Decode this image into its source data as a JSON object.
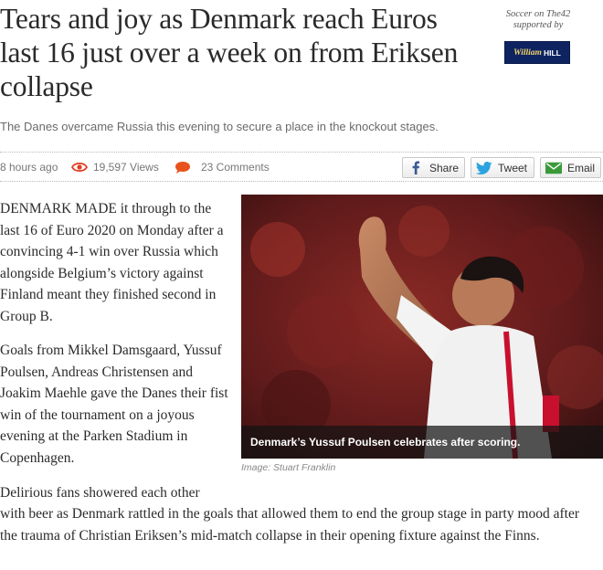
{
  "article": {
    "headline": "Tears and joy as Denmark reach Euros last 16 just over a week on from Eriksen collapse",
    "standfirst": "The Danes overcame Russia this evening to secure a place in the knockout stages.",
    "sponsor_line1": "Soccer on The42",
    "sponsor_line2": "supported by",
    "sponsor_logo": "William Hill",
    "sponsor_logo_script": "William",
    "sponsor_logo_bold": "HILL"
  },
  "meta": {
    "time": "8 hours ago",
    "views": "19,597 Views",
    "comments": "23 Comments",
    "views_icon": "eye-icon",
    "comments_icon": "speech-bubble-icon"
  },
  "share": {
    "facebook": "Share",
    "twitter": "Tweet",
    "email": "Email"
  },
  "body": {
    "p1": "DENMARK MADE it through to the last 16 of Euro 2020 on Monday after a convincing 4-1 win over Russia which alongside Belgium’s victory against Finland meant they finished second in Group B.",
    "p2": "Goals from Mikkel Damsgaard, Yussuf Poulsen, Andreas Christensen and Joakim Maehle gave the Danes their fist win of the tournament on a joyous evening at the Parken Stadium in Copenhagen.",
    "p3_a": "Delirious fans showered each other",
    "p3_b": "with beer as Denmark rattled in the goals that allowed them to end the group stage in party mood after the trauma of Christian Eriksen’s mid-match collapse in their opening fixture against the Finns."
  },
  "photo": {
    "caption": "Denmark’s Yussuf Poulsen celebrates after scoring.",
    "credit": "Image: Stuart Franklin"
  },
  "colors": {
    "headline": "#2a2a2a",
    "standfirst": "#6a6a6a",
    "eye": "#e23a1e",
    "comment": "#e8531d",
    "facebook": "#3b5998",
    "twitter": "#2aa3e0",
    "email": "#3a9a3a",
    "sponsor_bg": "#0d2461"
  }
}
